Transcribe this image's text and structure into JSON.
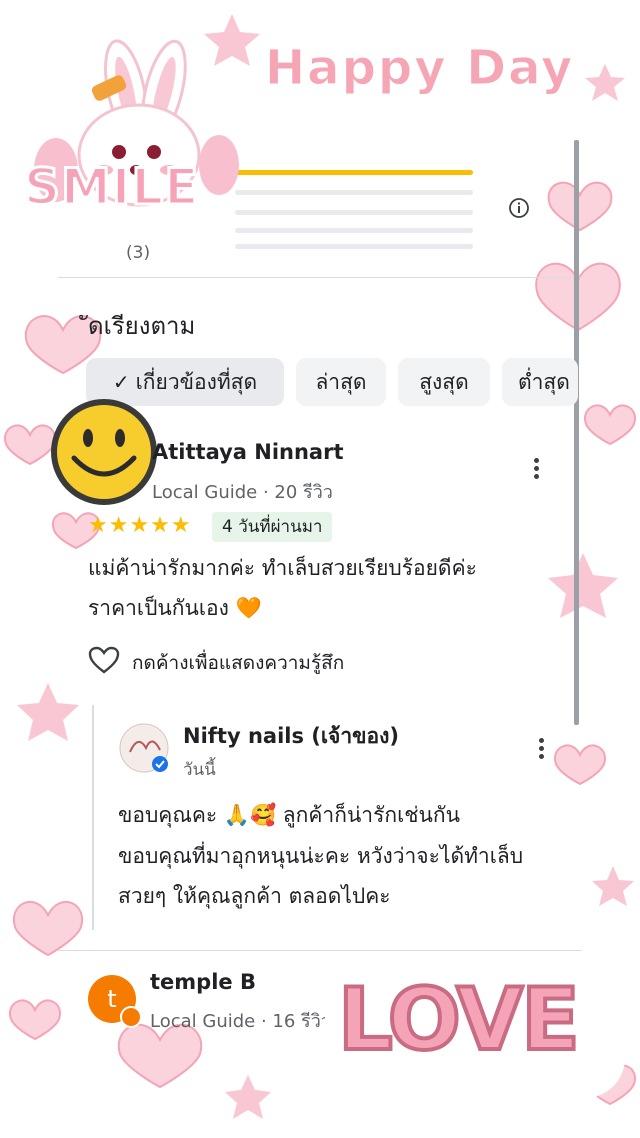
{
  "banner": {
    "title": "Happy Day",
    "sticker_smile": "SMILE",
    "sticker_love": "LOVE"
  },
  "summary": {
    "count_label": "(3)"
  },
  "sort": {
    "label": "ัดเรียงตาม",
    "chips": [
      {
        "label": "เกี่ยวข้องที่สุด",
        "selected": true
      },
      {
        "label": "ล่าสุด"
      },
      {
        "label": "สูงสุด"
      },
      {
        "label": "ต่ำสุด"
      }
    ]
  },
  "reviews": [
    {
      "name": "Atittaya Ninnart",
      "meta": "Local Guide · 20 รีวิว",
      "rating": 5,
      "stars": "★★★★★",
      "time": "4 วันที่ผ่านมา",
      "text_line1": "แม่ค้าน่ารักมากค่ะ ทำเล็บสวยเรียบร้อยดีค่ะ",
      "text_line2": "ราคาเป็นกันเอง 🧡",
      "like_label": "กดค้างเพื่อแสดงความรู้สึก",
      "owner_reply": {
        "name": "Nifty nails (เจ้าของ)",
        "time": "วันนี้",
        "line1": "ขอบคุณคะ 🙏🥰 ลูกค้าก็น่ารักเช่นกัน",
        "line2": "ขอบคุณที่มาอุกหนุนน่ะคะ หวังว่าจะได้ทำเล็บ",
        "line3": "สวยๆ ให้คุณลูกค้า ตลอดไปคะ"
      }
    },
    {
      "name": "temple B",
      "avatar_letter": "t",
      "meta": "Local Guide · 16 รีวิว"
    }
  ],
  "colors": {
    "accent_pink": "#f3a5b7",
    "star": "#fbbc04",
    "avatar_orange": "#f57c00",
    "time_badge": "#e6f4ea"
  }
}
